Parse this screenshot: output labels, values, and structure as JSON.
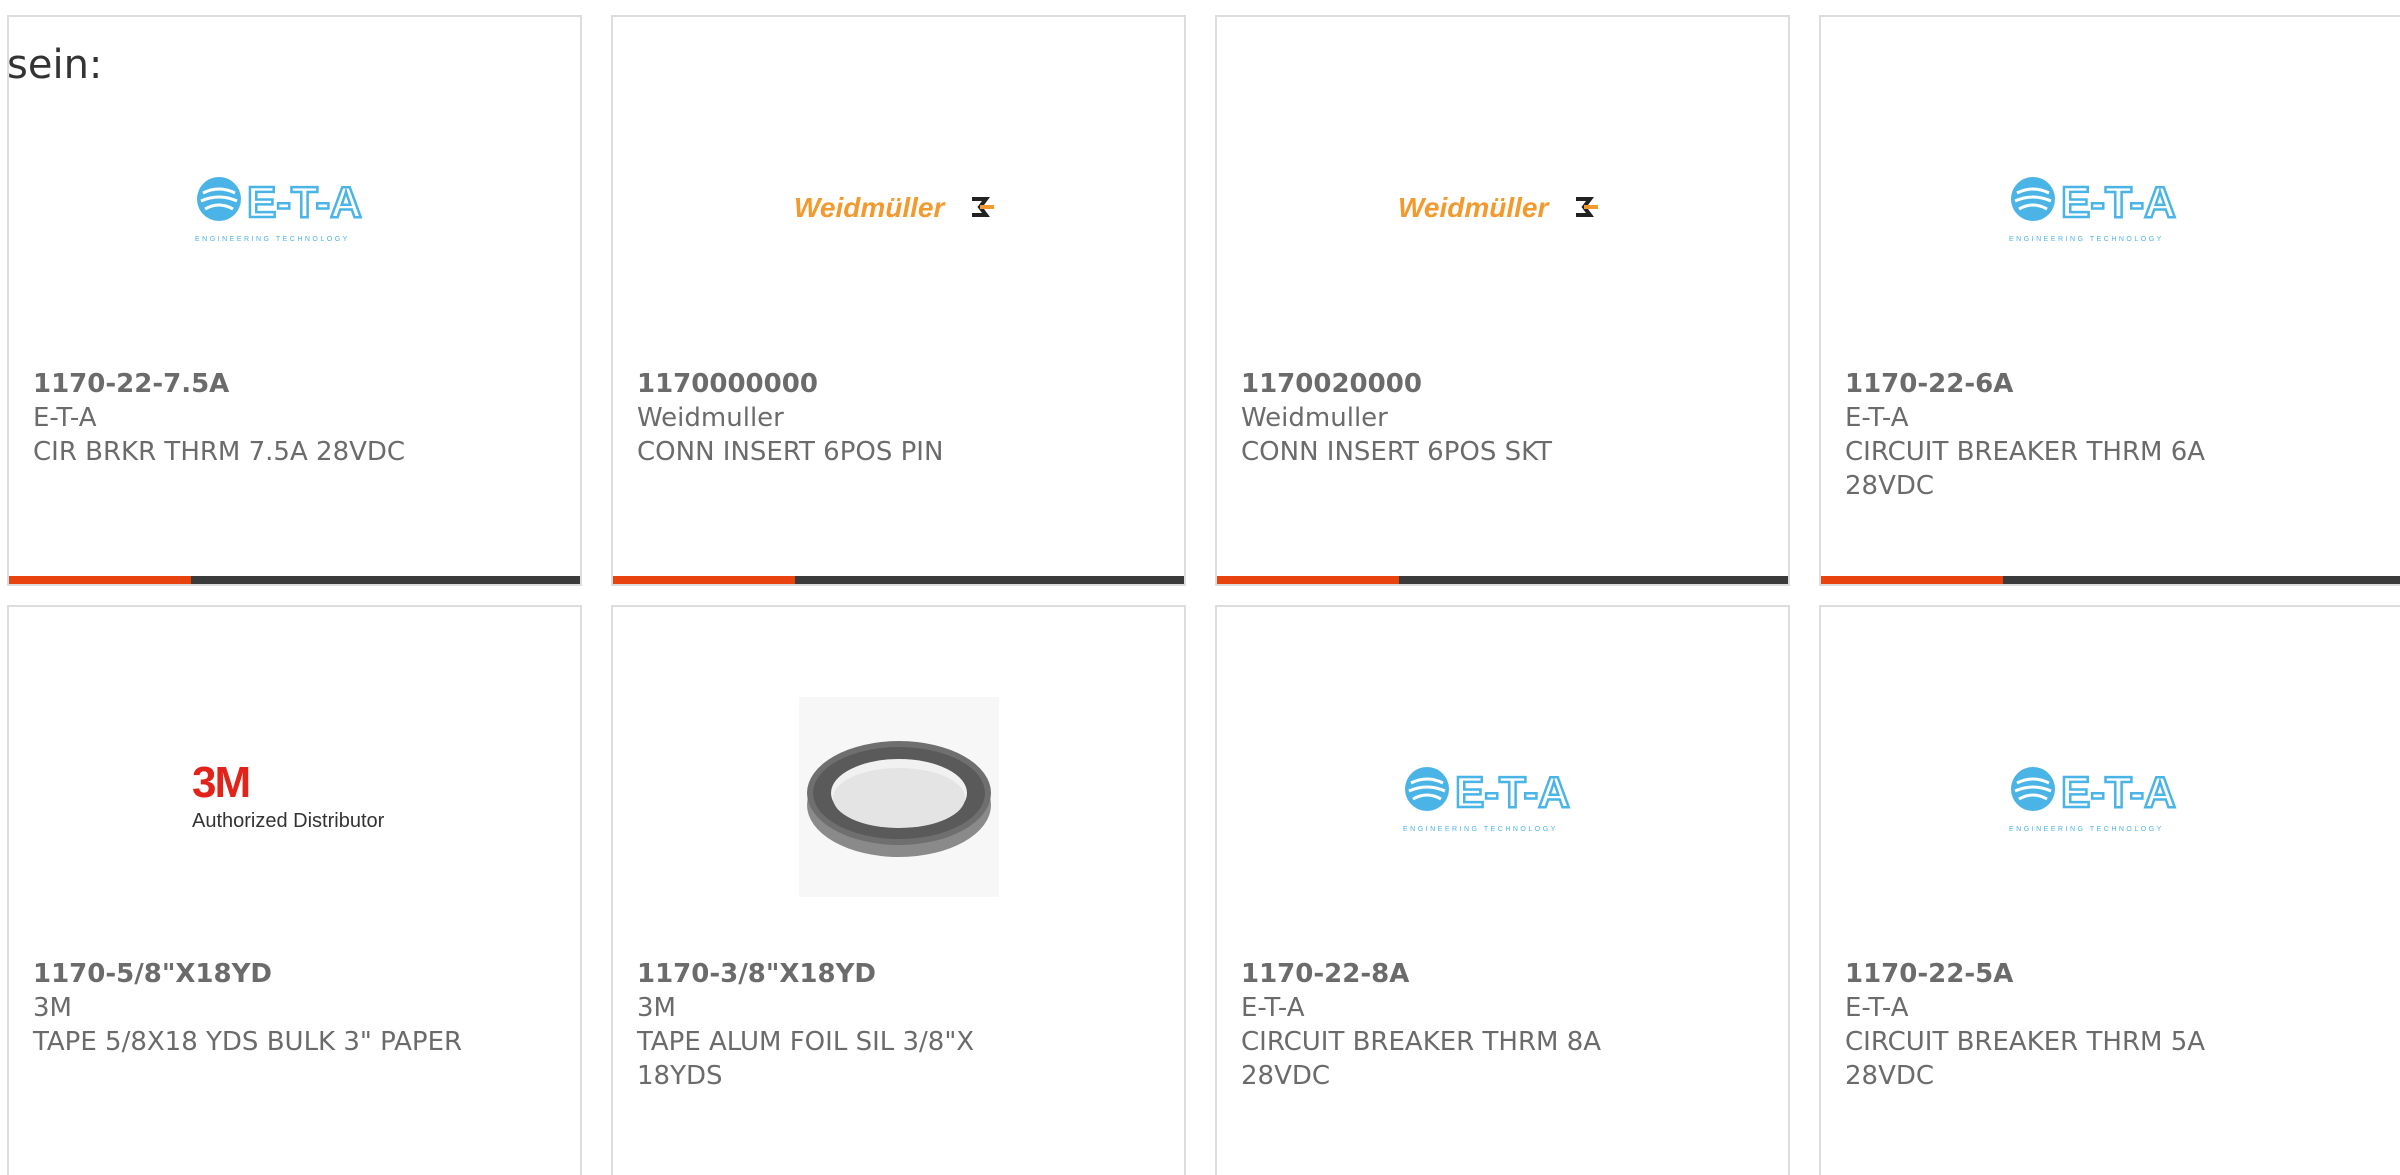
{
  "intro_text": "sein:",
  "colors": {
    "accent_bar": "#e8420f",
    "dark_bar": "#3a3a3a",
    "eta_blue": "#4ab4e6",
    "weidmuller_orange": "#f29a2e",
    "brand_3m_red": "#e2231a"
  },
  "products": [
    {
      "part_number": "1170-22-7.5A",
      "manufacturer": "E-T-A",
      "description": "CIR BRKR THRM 7.5A 28VDC",
      "logo": "eta-logo",
      "logo_text": "E-T-A",
      "logo_subtext": "ENGINEERING TECHNOLOGY"
    },
    {
      "part_number": "1170000000",
      "manufacturer": "Weidmuller",
      "description": "CONN INSERT 6POS PIN",
      "logo": "weidmuller-logo",
      "logo_text": "Weidmüller"
    },
    {
      "part_number": "1170020000",
      "manufacturer": "Weidmuller",
      "description": "CONN INSERT 6POS SKT",
      "logo": "weidmuller-logo",
      "logo_text": "Weidmüller"
    },
    {
      "part_number": "1170-22-6A",
      "manufacturer": "E-T-A",
      "description": "CIRCUIT BREAKER THRM 6A 28VDC",
      "logo": "eta-logo",
      "logo_text": "E-T-A",
      "logo_subtext": "ENGINEERING TECHNOLOGY"
    },
    {
      "part_number": "1170-5/8\"X18YD",
      "manufacturer": "3M",
      "description": "TAPE 5/8X18 YDS BULK 3\" PAPER",
      "logo": "3m-authorized-distributor-logo",
      "logo_text": "3M",
      "logo_subtext": "Authorized Distributor"
    },
    {
      "part_number": "1170-3/8\"X18YD",
      "manufacturer": "3M",
      "description": "TAPE ALUM FOIL SIL 3/8\"X 18YDS",
      "logo": "tape-roll-image"
    },
    {
      "part_number": "1170-22-8A",
      "manufacturer": "E-T-A",
      "description": "CIRCUIT BREAKER THRM 8A 28VDC",
      "logo": "eta-logo",
      "logo_text": "E-T-A",
      "logo_subtext": "ENGINEERING TECHNOLOGY"
    },
    {
      "part_number": "1170-22-5A",
      "manufacturer": "E-T-A",
      "description": "CIRCUIT BREAKER THRM 5A 28VDC",
      "logo": "eta-logo",
      "logo_text": "E-T-A",
      "logo_subtext": "ENGINEERING TECHNOLOGY"
    }
  ]
}
